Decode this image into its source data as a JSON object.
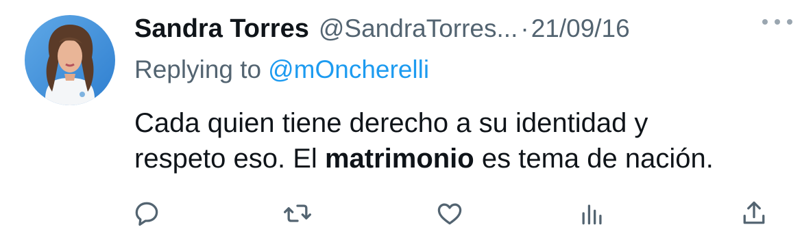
{
  "tweet": {
    "author_name": "Sandra Torres",
    "author_handle": "@SandraTorres...",
    "separator": "·",
    "date": "21/09/16",
    "reply_prefix": "Replying to",
    "reply_to_handle": "@mOncherelli",
    "body": {
      "line1": "Cada quien tiene derecho a su identidad y",
      "line2_before": "respeto eso. El ",
      "line2_bold": "matrimonio",
      "line2_after": " es tema de nación."
    }
  },
  "icons": {
    "avatar": "profile-photo",
    "more": "more-options-icon",
    "reply": "reply-icon",
    "retweet": "retweet-icon",
    "like": "like-icon",
    "views": "views-icon",
    "share": "share-icon"
  },
  "colors": {
    "text": "#0f1419",
    "muted": "#536471",
    "link": "#1d9bf0",
    "icon": "#536471"
  }
}
